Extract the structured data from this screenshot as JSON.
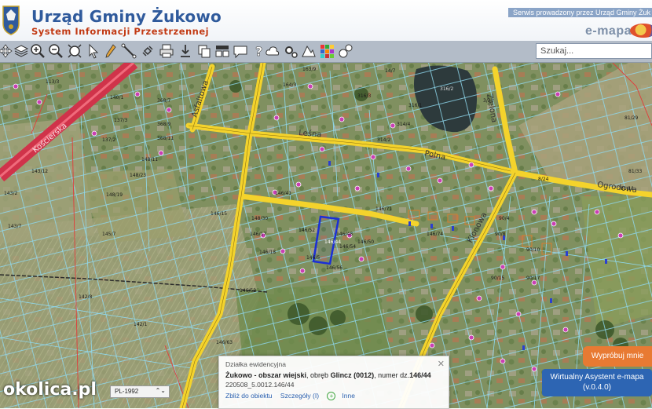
{
  "header": {
    "title": "Urząd Gminy Żukowo",
    "subtitle": "System Informacji Przestrzennej",
    "service_note": "Serwis prowadzony przez Urząd Gminy Żuk",
    "brand": "e-mapa"
  },
  "toolbar": {
    "tools": [
      "pan-icon",
      "layers-icon",
      "zoom-in-icon",
      "zoom-out-icon",
      "zoom-extent-icon",
      "select-arrow-icon",
      "pencil-icon",
      "measure-icon",
      "link-icon",
      "print-icon",
      "download-icon",
      "copy-icon",
      "layout-icon",
      "comment-icon",
      "help-icon",
      "cloud-icon",
      "settings-icon",
      "terrain-icon",
      "color-grid-icon",
      "locate-icon"
    ],
    "search_placeholder": "Szukaj..."
  },
  "map": {
    "street_labels": [
      "Kościerska",
      "Asfaltowa",
      "Leśna",
      "Polna",
      "Zielona",
      "Klonowa",
      "Ogrodowa"
    ],
    "parcel_labels": [
      "113/3",
      "140/1",
      "137/3",
      "137/2",
      "368/7",
      "368/9",
      "368/11",
      "148/23",
      "148/11",
      "143/7",
      "143/2",
      "143/12",
      "148/19",
      "146/15",
      "148/30",
      "146/18",
      "146/17",
      "146/71",
      "146/74",
      "146/41",
      "146/48",
      "146/50",
      "146/52",
      "146/54",
      "146/56",
      "142/8",
      "142/1",
      "146/63",
      "146/53",
      "316/1",
      "316/3",
      "3/21",
      "81/29",
      "81/33",
      "81/11",
      "90/15",
      "90/17",
      "90/10",
      "90/4",
      "90/8",
      "14/7",
      "146/44",
      "146/5",
      "145/7",
      "163/9",
      "164/3",
      "316/2",
      "314/4",
      "314/2",
      "8/24"
    ]
  },
  "popup": {
    "header": "Działka ewidencyjna",
    "location": "Żukowo - obszar wiejski",
    "location_rest": ", obręb ",
    "district": "Glincz (0012)",
    "number_prefix": ", numer dz.",
    "number": "146/44",
    "identifier": "220508_5.0012.146/44",
    "link_zoom": "Zbliż do obiektu",
    "link_details": "Szczegóły (I)",
    "link_other": "Inne"
  },
  "footer": {
    "watermark": "okolica.pl",
    "crs_value": "PL-1992"
  },
  "buttons": {
    "try_me": "Wypróbuj mnie",
    "assistant_line1": "Wirtualny Asystent e-mapa",
    "assistant_line2": "(v.0.4.0)"
  },
  "colors": {
    "road": "#f4d32c",
    "main_road": "#d0334a",
    "parcel_border": "#7fd0e8",
    "selected_parcel": "#1b2fd6",
    "accent_orange": "#e87a33",
    "accent_blue": "#2d65b3"
  }
}
